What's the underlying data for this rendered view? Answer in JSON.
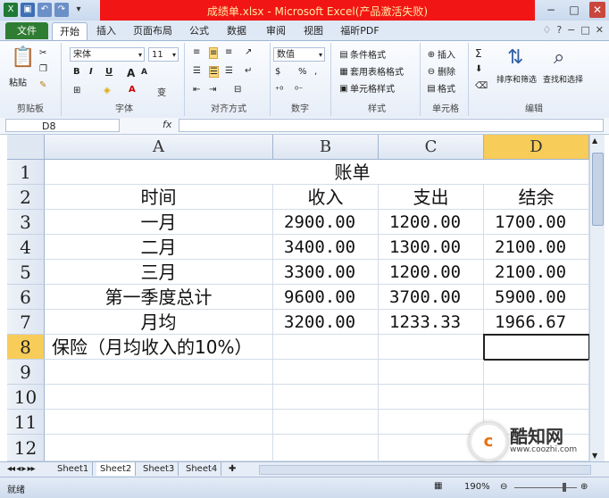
{
  "window": {
    "title": "成绩单.xlsx - Microsoft Excel(产品激活失败)",
    "controls": [
      "−",
      "□",
      "✕"
    ]
  },
  "qat": [
    "X",
    "💾",
    "↶",
    "↷",
    "▾"
  ],
  "tabs": [
    "文件",
    "开始",
    "插入",
    "页面布局",
    "公式",
    "数据",
    "审阅",
    "视图",
    "福昕PDF"
  ],
  "tab_icons": [
    "♢",
    "?",
    "−",
    "□",
    "✕"
  ],
  "ribbon": {
    "clipboard": {
      "label": "剪贴板",
      "paste": "粘贴"
    },
    "font": {
      "label": "字体",
      "name": "宋体",
      "size": "11",
      "bold": "B",
      "italic": "I",
      "underline": "U",
      "grow": "A",
      "shrink": "A",
      "wen": "变"
    },
    "alignment": {
      "label": "对齐方式"
    },
    "number": {
      "label": "数字",
      "format": "数值",
      "percent": "%",
      "comma": ","
    },
    "styles": {
      "label": "样式",
      "cond": "条件格式",
      "table": "套用表格格式",
      "cell": "单元格样式"
    },
    "cells": {
      "label": "单元格",
      "insert": "插入",
      "delete": "删除",
      "format": "格式"
    },
    "editing": {
      "label": "编辑",
      "sigma": "Σ",
      "sort": "排序和筛选",
      "find": "查找和选择"
    }
  },
  "formula_bar": {
    "name_box": "D8",
    "fx": "fx",
    "value": ""
  },
  "columns": [
    "A",
    "B",
    "C",
    "D"
  ],
  "rows": [
    "1",
    "2",
    "3",
    "4",
    "5",
    "6",
    "7",
    "8",
    "9",
    "10",
    "11",
    "12"
  ],
  "cells": {
    "title": "账单",
    "header": [
      "时间",
      "收入",
      "支出",
      "结余"
    ],
    "data": [
      [
        "一月",
        "2900.00",
        "1200.00",
        "1700.00"
      ],
      [
        "二月",
        "3400.00",
        "1300.00",
        "2100.00"
      ],
      [
        "三月",
        "3300.00",
        "1200.00",
        "2100.00"
      ],
      [
        "第一季度总计",
        "9600.00",
        "3700.00",
        "5900.00"
      ],
      [
        "月均",
        "3200.00",
        "1233.33",
        "1966.67"
      ]
    ],
    "insurance": "保险（月均收入的10%）"
  },
  "sheet_tabs": [
    "Sheet1",
    "Sheet2",
    "Sheet3",
    "Sheet4"
  ],
  "status": {
    "ready": "就绪",
    "zoom": "190%"
  },
  "watermark": {
    "brand": "酷知网",
    "url": "www.coozhi.com"
  }
}
